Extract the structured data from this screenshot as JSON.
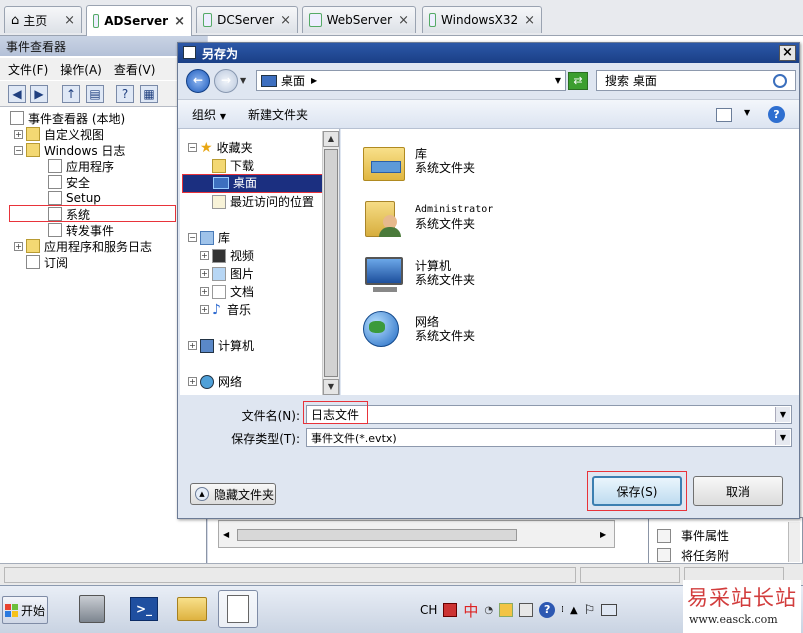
{
  "browser_tabs": [
    {
      "label": "主页"
    },
    {
      "label": "ADServer"
    },
    {
      "label": "DCServer"
    },
    {
      "label": "WebServer"
    },
    {
      "label": "WindowsX32"
    }
  ],
  "event_viewer": {
    "title": "事件查看器",
    "menu": [
      "文件(F)",
      "操作(A)",
      "查看(V)"
    ],
    "tree": [
      {
        "label": "事件查看器 (本地)"
      },
      {
        "label": "自定义视图"
      },
      {
        "label": "Windows 日志"
      },
      {
        "label": "应用程序"
      },
      {
        "label": "安全"
      },
      {
        "label": "Setup"
      },
      {
        "label": "系统"
      },
      {
        "label": "转发事件"
      },
      {
        "label": "应用程序和服务日志"
      },
      {
        "label": "订阅"
      }
    ],
    "right_actions": [
      "事件属性",
      "将任务附"
    ]
  },
  "dialog": {
    "title": "另存为",
    "address": "桌面",
    "search_placeholder": "搜索 桌面",
    "toolbar": {
      "organize": "组织",
      "new_folder": "新建文件夹"
    },
    "nav": {
      "favorites": "收藏夹",
      "downloads": "下载",
      "desktop": "桌面",
      "recent": "最近访问的位置",
      "libraries": "库",
      "videos": "视频",
      "pictures": "图片",
      "documents": "文档",
      "music": "音乐",
      "computer": "计算机",
      "network": "网络"
    },
    "items": [
      {
        "name": "库",
        "type": "系统文件夹"
      },
      {
        "name": "Administrator",
        "type": "系统文件夹"
      },
      {
        "name": "计算机",
        "type": "系统文件夹"
      },
      {
        "name": "网络",
        "type": "系统文件夹"
      }
    ],
    "filename_label": "文件名(N):",
    "filename_value": "日志文件",
    "filetype_label": "保存类型(T):",
    "filetype_value": "事件文件(*.evtx)",
    "hide_folders": "隐藏文件夹",
    "save": "保存(S)",
    "cancel": "取消"
  },
  "taskbar": {
    "start": "开始",
    "tray_lang": "CH",
    "tray_ime": "中"
  },
  "watermark": {
    "text": "易采站长站",
    "url": "www.easck.com"
  }
}
